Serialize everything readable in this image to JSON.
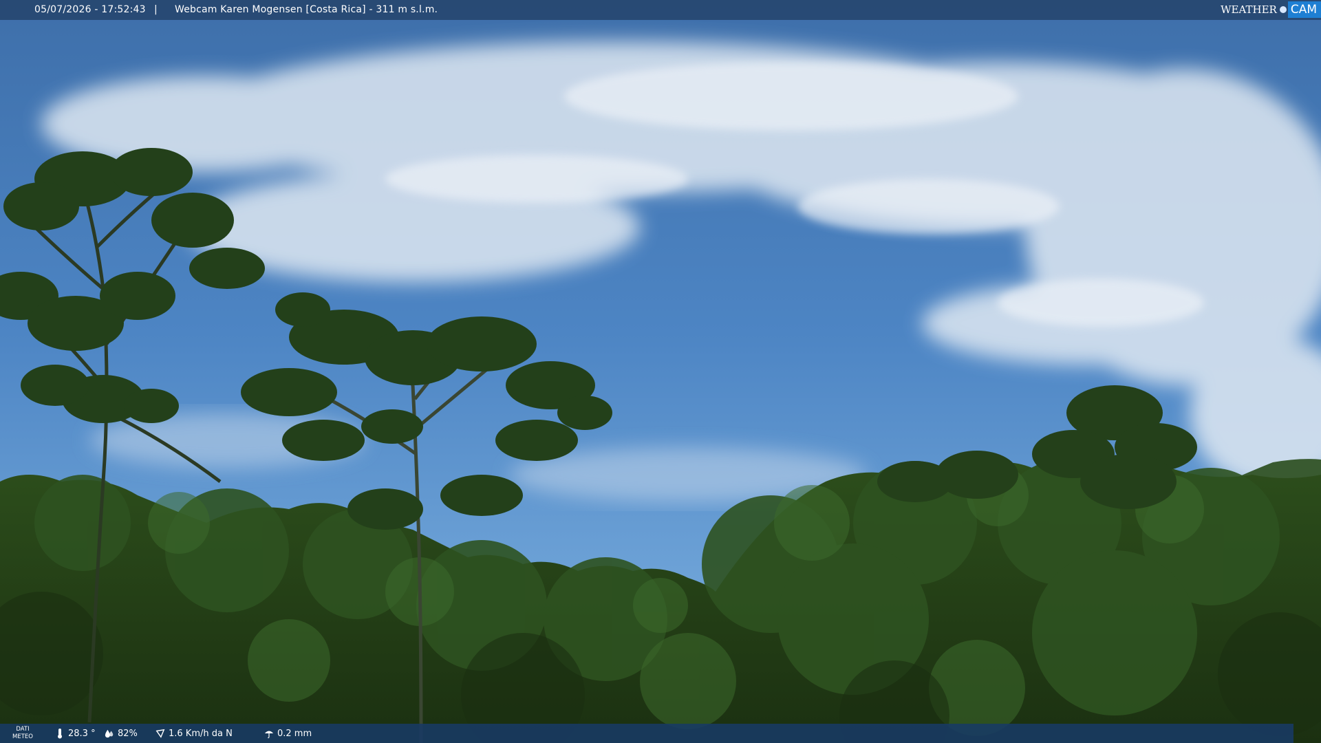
{
  "header": {
    "datetime": "05/07/2026 - 17:52:43",
    "separator": "|",
    "title": "Webcam Karen Mogensen [Costa Rica]  - 311 m s.l.m."
  },
  "logo": {
    "text_weather": "WEATHER",
    "text_cam": "CAM"
  },
  "footer": {
    "label_line1": "DATI",
    "label_line2": "METEO",
    "temperature": "28.3 °",
    "humidity": "82%",
    "wind": "1.6 Km/h da N",
    "rain": "0.2 mm"
  },
  "icons": [
    "thermometer-icon",
    "humidity-icon",
    "wind-icon",
    "rain-icon"
  ]
}
